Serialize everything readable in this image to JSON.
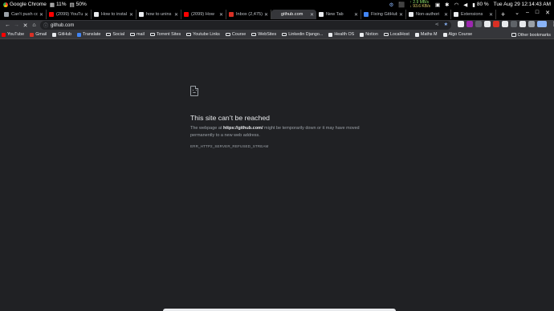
{
  "os_bar": {
    "app_name": "Google Chrome",
    "cpu": "11%",
    "memory": "50%",
    "net_up": "↑ 2.9 MB/s",
    "net_down": "↓ 93.6 KB/s",
    "battery": "80 %",
    "datetime": "Tue Aug 29  12:14:43 AM"
  },
  "tabs": [
    {
      "title": "Can't push co",
      "color": "#9aa0a6"
    },
    {
      "title": "(2099) YouTub",
      "color": "#ff0000"
    },
    {
      "title": "How to instal",
      "color": "#e8eaed"
    },
    {
      "title": "how to unins",
      "color": "#e8eaed"
    },
    {
      "title": "(2099) How",
      "color": "#ff0000"
    },
    {
      "title": "Inbox (2,475)",
      "color": "#d93025"
    },
    {
      "title": "github.com",
      "color": "#35363a"
    },
    {
      "title": "New Tab",
      "color": "#e8eaed"
    },
    {
      "title": "Fixing GitHub",
      "color": "#4285f4"
    },
    {
      "title": "Non-authori",
      "color": "#e8eaed"
    },
    {
      "title": "Extensions",
      "color": "#e8eaed"
    }
  ],
  "active_tab_index": 6,
  "toolbar": {
    "url": "github.com"
  },
  "bookmarks": [
    {
      "label": "YouTube",
      "kind": "icon",
      "color": "#ff0000"
    },
    {
      "label": "Gmail",
      "kind": "icon",
      "color": "#d93025"
    },
    {
      "label": "GitHub",
      "kind": "icon",
      "color": "#e8eaed"
    },
    {
      "label": "Translate",
      "kind": "icon",
      "color": "#4285f4"
    },
    {
      "label": "Social",
      "kind": "folder"
    },
    {
      "label": "mail",
      "kind": "folder"
    },
    {
      "label": "Torrent Sites",
      "kind": "folder"
    },
    {
      "label": "Youtube Links",
      "kind": "folder"
    },
    {
      "label": "Course",
      "kind": "folder"
    },
    {
      "label": "WebSites",
      "kind": "folder"
    },
    {
      "label": "Linkedin Django...",
      "kind": "folder"
    },
    {
      "label": "Health OS",
      "kind": "icon",
      "color": "#e8eaed"
    },
    {
      "label": "Notion",
      "kind": "icon",
      "color": "#e8eaed"
    },
    {
      "label": "LocalHost",
      "kind": "folder"
    },
    {
      "label": "Maths M",
      "kind": "icon",
      "color": "#e8eaed"
    },
    {
      "label": "Algo Course",
      "kind": "icon",
      "color": "#e8eaed"
    }
  ],
  "bookmarks_other": "Other bookmarks",
  "error": {
    "title": "This site can’t be reached",
    "desc_prefix": "The webpage at ",
    "desc_url": "https://github.com/",
    "desc_suffix": " might be temporarily down or it may have moved permanently to a new web address.",
    "code": "ERR_HTTP2_SERVER_REFUSED_STREAM"
  }
}
